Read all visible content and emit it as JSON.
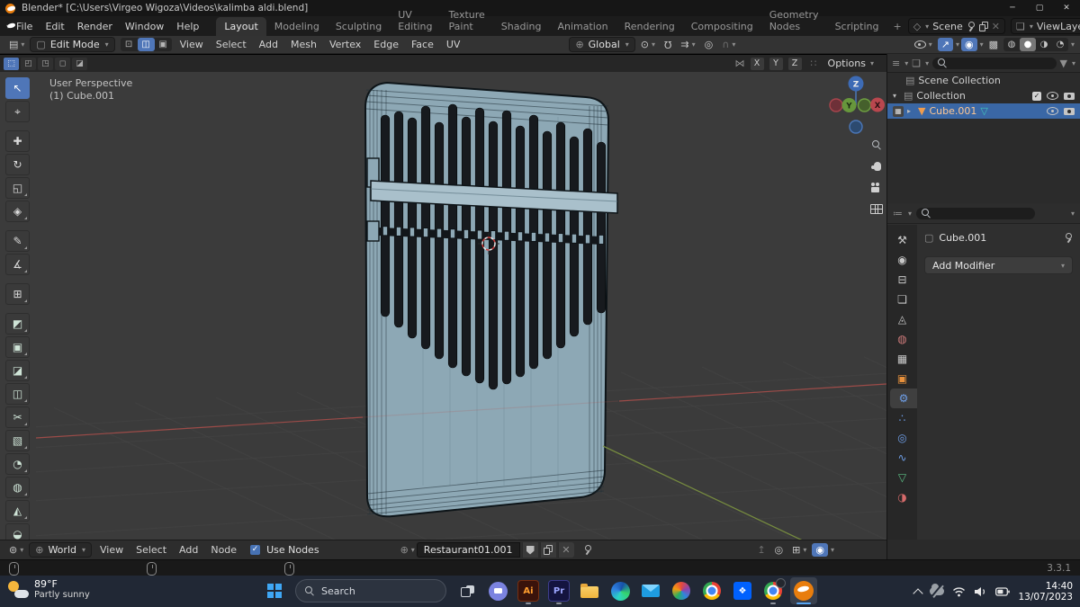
{
  "window": {
    "title": "Blender* [C:\\Users\\Virgeo Wigoza\\Videos\\kalimba aldi.blend]",
    "minimize": "─",
    "maximize": "▢",
    "close": "✕"
  },
  "menubar": {
    "menus": [
      "File",
      "Edit",
      "Render",
      "Window",
      "Help"
    ],
    "workspaces": [
      "Layout",
      "Modeling",
      "Sculpting",
      "UV Editing",
      "Texture Paint",
      "Shading",
      "Animation",
      "Rendering",
      "Compositing",
      "Geometry Nodes",
      "Scripting"
    ],
    "active_workspace": "Layout",
    "add_tab": "+",
    "scene_label": "Scene",
    "viewlayer_label": "ViewLayer"
  },
  "tool_header": {
    "mode_label": "Edit Mode",
    "select_modes": [
      {
        "name": "vertex",
        "glyph": "⊡"
      },
      {
        "name": "edge",
        "glyph": "◫"
      },
      {
        "name": "face",
        "glyph": "▣"
      }
    ],
    "active_select_mode": "edge",
    "menus": [
      "View",
      "Select",
      "Add",
      "Mesh",
      "Vertex",
      "Edge",
      "Face",
      "UV"
    ],
    "orientation_label": "Global",
    "options_label": "Options"
  },
  "tool_settings": {
    "axes": [
      "X",
      "Y",
      "Z"
    ]
  },
  "toolbar": {
    "tools": [
      {
        "name": "tweak-select",
        "glyph": "↖"
      },
      {
        "name": "cursor",
        "glyph": "⌖"
      },
      {
        "name": "move",
        "glyph": "✚"
      },
      {
        "name": "rotate",
        "glyph": "↻"
      },
      {
        "name": "scale",
        "glyph": "◱"
      },
      {
        "name": "transform",
        "glyph": "◈"
      },
      {
        "name": "annotate",
        "glyph": "✎"
      },
      {
        "name": "measure",
        "glyph": "∡"
      },
      {
        "name": "add-cube",
        "glyph": "⊞"
      },
      {
        "name": "extrude-region",
        "glyph": "◩"
      },
      {
        "name": "inset-faces",
        "glyph": "▣"
      },
      {
        "name": "bevel",
        "glyph": "◪"
      },
      {
        "name": "loop-cut",
        "glyph": "◫"
      },
      {
        "name": "knife",
        "glyph": "✂"
      },
      {
        "name": "poly-build",
        "glyph": "▧"
      },
      {
        "name": "spin",
        "glyph": "◔"
      },
      {
        "name": "smooth",
        "glyph": "◍"
      },
      {
        "name": "edge-slide",
        "glyph": "◭"
      },
      {
        "name": "shrink-fatten",
        "glyph": "◒"
      }
    ]
  },
  "viewport": {
    "view_label": "User Perspective",
    "object_label": "(1) Cube.001",
    "axis_x": "X",
    "axis_y": "Y",
    "axis_z": "Z"
  },
  "outliner": {
    "scene_collection": "Scene Collection",
    "collection": "Collection",
    "object_name": "Cube.001"
  },
  "properties": {
    "breadcrumb": "Cube.001",
    "add_modifier_label": "Add Modifier",
    "tabs": [
      {
        "name": "tool",
        "glyph": "⚒",
        "color": "#c8c8c8"
      },
      {
        "name": "render",
        "glyph": "◉",
        "color": "#c8c8c8"
      },
      {
        "name": "output",
        "glyph": "⊟",
        "color": "#c8c8c8"
      },
      {
        "name": "view-layer",
        "glyph": "❏",
        "color": "#c8c8c8"
      },
      {
        "name": "scene",
        "glyph": "◬",
        "color": "#c8c8c8"
      },
      {
        "name": "world",
        "glyph": "◍",
        "color": "#cd7a7a"
      },
      {
        "name": "collection",
        "glyph": "▦",
        "color": "#c8c8c8"
      },
      {
        "name": "object",
        "glyph": "▣",
        "color": "#e8913c"
      },
      {
        "name": "modifiers",
        "glyph": "⚙",
        "color": "#6f9fe8"
      },
      {
        "name": "particles",
        "glyph": "∴",
        "color": "#6f9fe8"
      },
      {
        "name": "physics",
        "glyph": "◎",
        "color": "#6f9fe8"
      },
      {
        "name": "constraints",
        "glyph": "∿",
        "color": "#6f9fe8"
      },
      {
        "name": "object-data",
        "glyph": "▽",
        "color": "#5cbf85"
      },
      {
        "name": "material",
        "glyph": "◑",
        "color": "#d56a6a"
      }
    ],
    "active_tab": "modifiers"
  },
  "shader_editor": {
    "world_label": "World",
    "menus": [
      "View",
      "Select",
      "Add",
      "Node"
    ],
    "use_nodes_label": "Use Nodes",
    "material_name": "Restaurant01.001"
  },
  "status_bar": {
    "version": "3.3.1"
  },
  "taskbar": {
    "weather_temp": "89°F",
    "weather_desc": "Partly sunny",
    "search_placeholder": "Search",
    "illustrator_label": "Ai",
    "premiere_label": "Pr",
    "time": "14:40",
    "date": "13/07/2023"
  },
  "colors": {
    "accent": "#4f76b8",
    "selection": "#3a67a5",
    "blender_orange": "#e87d0d",
    "model_body": "#8da8b5",
    "axis_x_red": "#b5504c",
    "axis_y_green": "#7d9440"
  }
}
